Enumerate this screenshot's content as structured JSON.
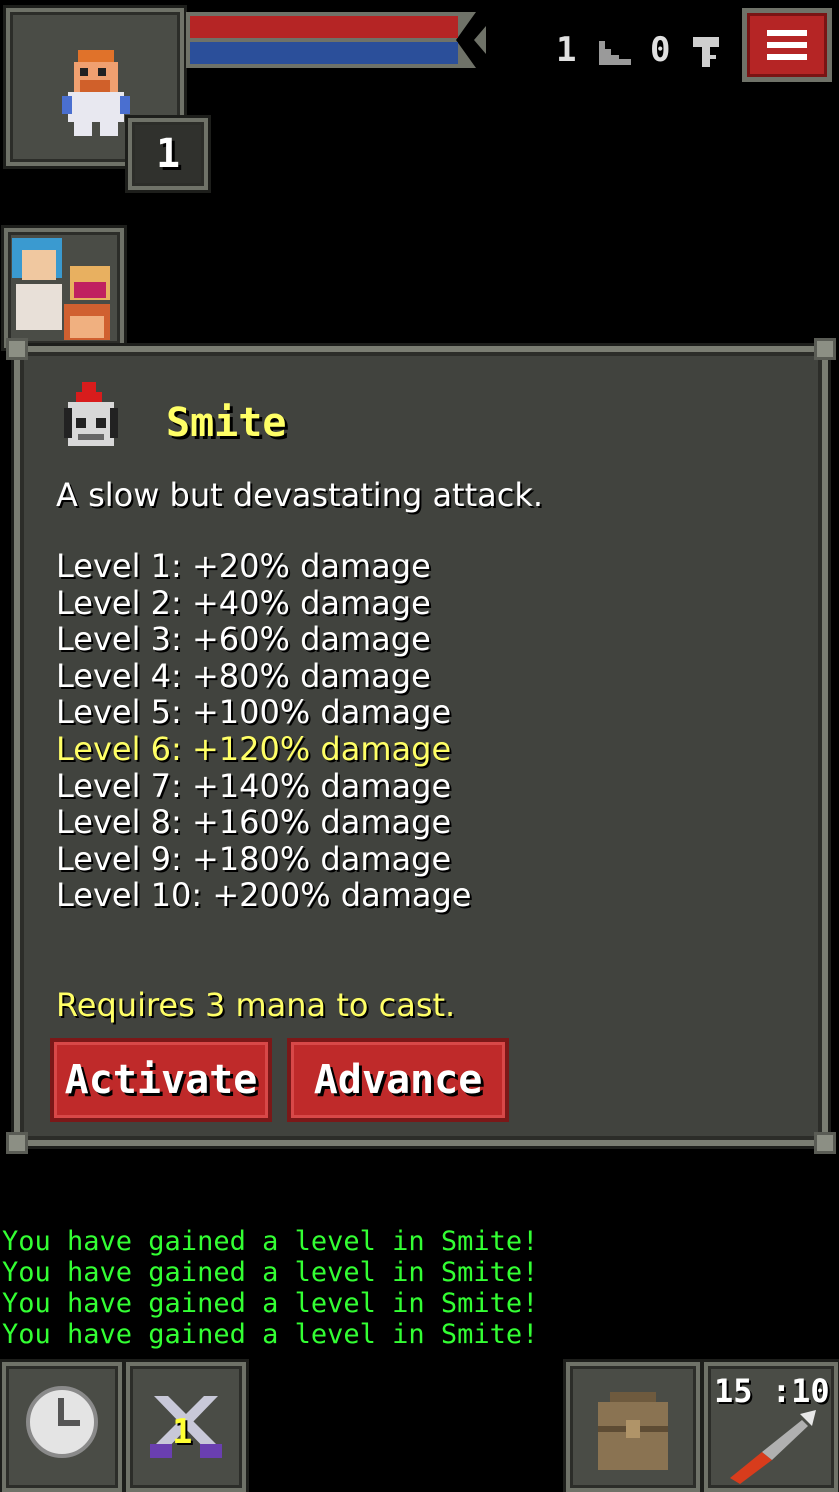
{
  "hud": {
    "hero_level": "1",
    "depth": "1",
    "keys": "0",
    "hp_fraction": 1.0,
    "hp_color": "#b52525",
    "shield_color": "#2b4f9a"
  },
  "dialog": {
    "title": "Smite",
    "description": "A slow but devastating attack.",
    "levels": [
      "Level 1: +20% damage",
      "Level 2: +40% damage",
      "Level 3: +60% damage",
      "Level 4: +80% damage",
      "Level 5: +100% damage",
      "Level 6: +120% damage",
      "Level 7: +140% damage",
      "Level 8: +160% damage",
      "Level 9: +180% damage",
      "Level 10: +200% damage"
    ],
    "current_level": 6,
    "requirement": "Requires 3 mana to cast.",
    "activate_label": "Activate",
    "advance_label": "Advance"
  },
  "log": [
    "You have gained a level in Smite!",
    "You have gained a level in Smite!",
    "You have gained a level in Smite!",
    "You have gained a level in Smite!"
  ],
  "toolbar": {
    "wait_icon": "clock-icon",
    "weapon_badge": "1",
    "backpack_icon": "backpack-icon",
    "item_count": "15",
    "item_charge": ":10"
  },
  "colors": {
    "highlight": "#ffff66",
    "log_text": "#33ff33",
    "button_red": "#bf2a2a"
  }
}
